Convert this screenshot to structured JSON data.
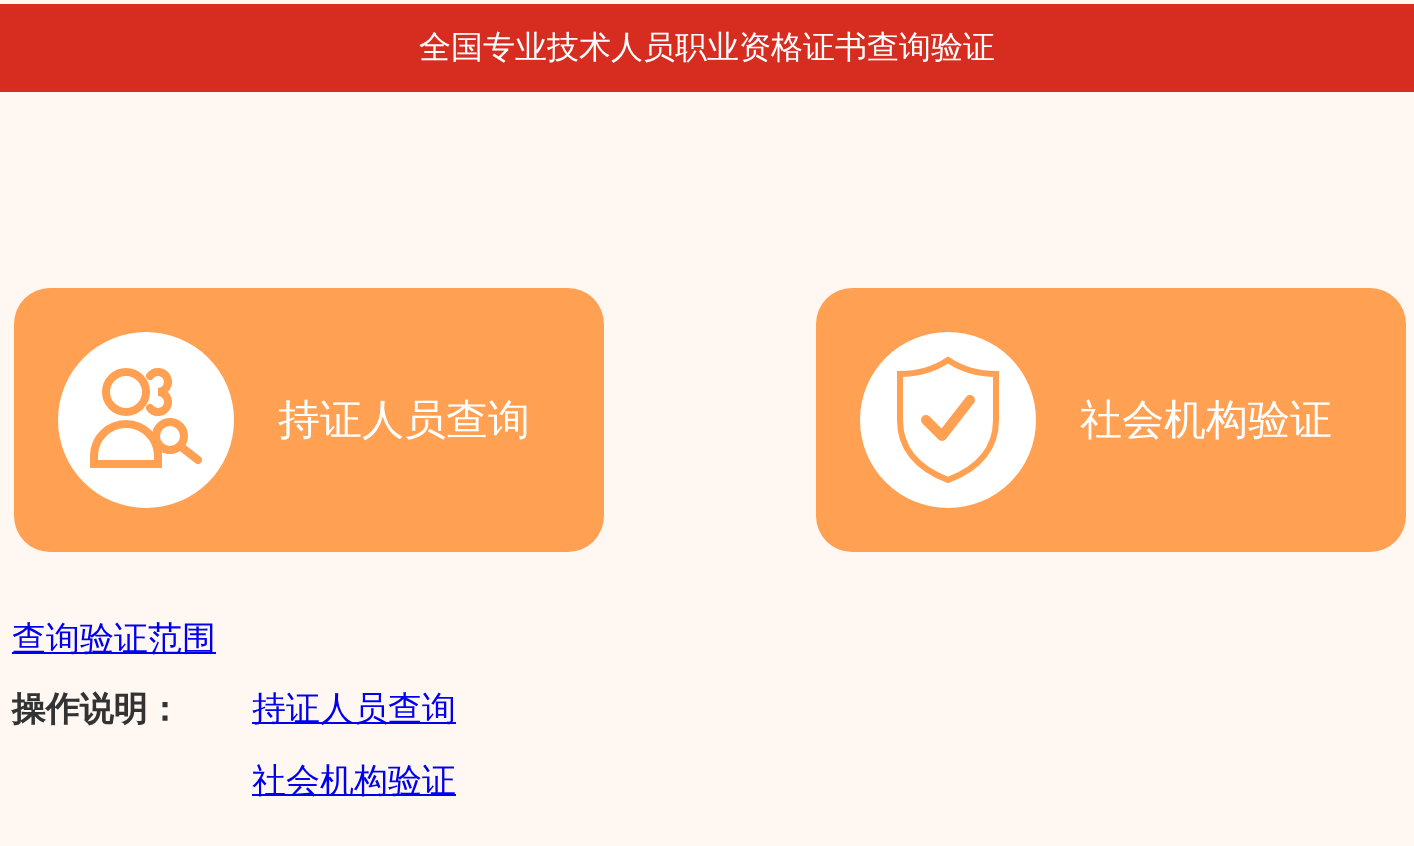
{
  "header": {
    "title": "全国专业技术人员职业资格证书查询验证"
  },
  "cards": [
    {
      "kind": "person-search",
      "label": "持证人员查询"
    },
    {
      "kind": "shield",
      "label": "社会机构验证"
    }
  ],
  "scope_link": "查询验证范围",
  "instructions": {
    "label": "操作说明：",
    "links": [
      "持证人员查询",
      "社会机构验证"
    ]
  }
}
